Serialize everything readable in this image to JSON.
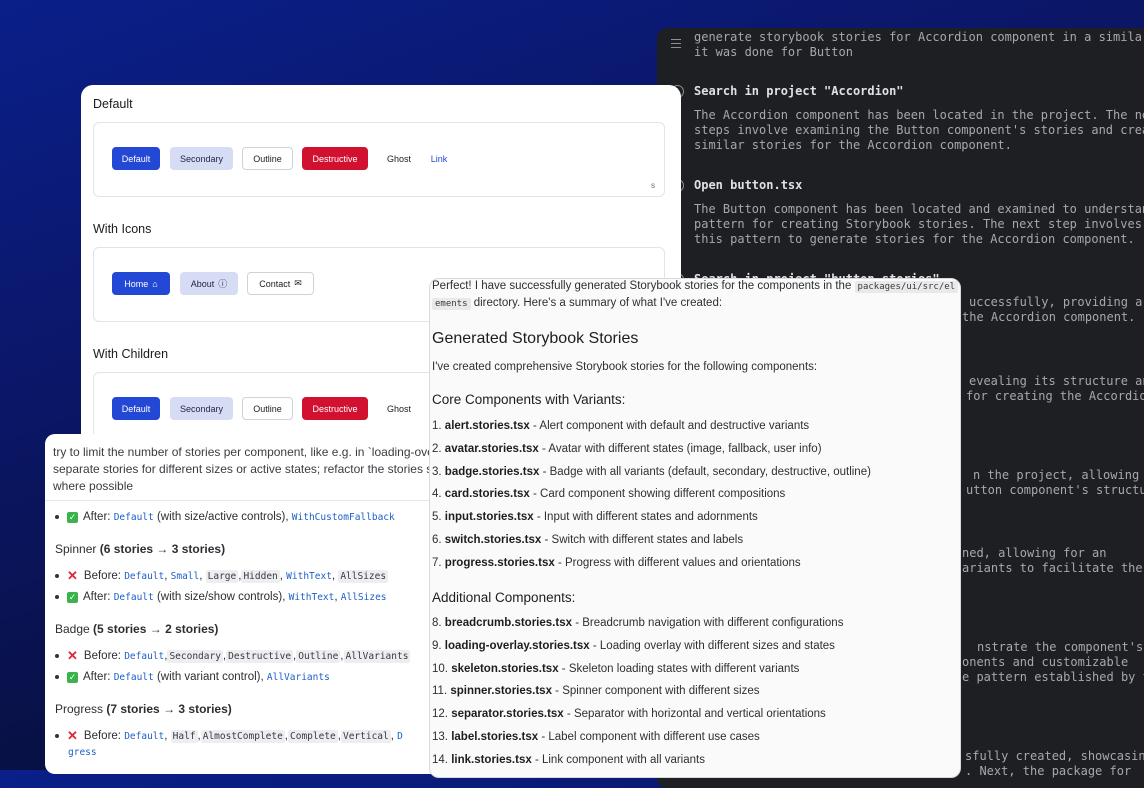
{
  "log": {
    "prompt": "generate storybook stories for Accordion component in a similar way as\nit was done for Button",
    "entries": [
      {
        "title": "Search in project \"Accordion\"",
        "body": "The Accordion component has been located in the project. The next\nsteps involve examining the Button component's stories and creating\nsimilar stories for the Accordion component."
      },
      {
        "title": "Open button.tsx",
        "body": "The Button component has been located and examined to understand the\npattern for creating Storybook stories. The next step involves using\nthis pattern to generate stories for the Accordion component."
      },
      {
        "title": "Search in project \"button.stories\"",
        "body": ""
      }
    ],
    "fragments": [
      "uccessfully, providing a",
      "the Accordion component.",
      "evealing its structure and",
      "for creating the Accordion",
      "n the project, allowing for",
      "utton component's structure.",
      "ned, allowing for an",
      "ariants to facilitate the",
      "nstrate the component's",
      "onents and customizable",
      "e pattern established by the",
      "sfully created, showcasing",
      ". Next, the package for"
    ]
  },
  "showcase": {
    "sections": [
      {
        "title": "Default",
        "buttons": [
          "Default",
          "Secondary",
          "Outline",
          "Destructive",
          "Ghost",
          "Link"
        ]
      },
      {
        "title": "With Icons",
        "buttons": [
          "Home",
          "About",
          "Contact"
        ]
      },
      {
        "title": "With Children",
        "buttons": [
          "Default",
          "Secondary",
          "Outline",
          "Destructive",
          "Ghost"
        ]
      }
    ],
    "cut_label": "s"
  },
  "refactor": {
    "intro_lines": [
      "try to limit the number of stories per component, like e.g. in `loading-over",
      "separate stories for different sizes or active states; refactor the stories so t",
      "where possible"
    ],
    "after_prefix": "After:",
    "before_prefix": "Before:",
    "avatar_after": {
      "note": "(with size/active controls),",
      "codes": [
        "Default",
        "WithCustomFallback"
      ]
    },
    "spinner": {
      "name": "Spinner",
      "count": "(6 stories → 3 stories)",
      "before": [
        "Default",
        "Small",
        "Large",
        "Hidden",
        "WithText",
        "AllSizes"
      ],
      "after_note": "(with size/show controls),",
      "after": [
        "Default",
        "WithText",
        "AllSizes"
      ]
    },
    "badge": {
      "name": "Badge",
      "count": "(5 stories → 2 stories)",
      "before": [
        "Default",
        "Secondary",
        "Destructive",
        "Outline",
        "AllVariants"
      ],
      "after_note": "(with variant control),",
      "after": [
        "Default",
        "AllVariants"
      ]
    },
    "progress": {
      "name": "Progress",
      "count": "(7 stories → 3 stories)",
      "before": [
        "Default",
        "Half",
        "AlmostComplete",
        "Complete",
        "Vertical",
        "D"
      ],
      "wrap": "gress"
    }
  },
  "summary": {
    "intro1": "Perfect! I have successfully generated Storybook stories for the components in the",
    "path_a": "packages/ui/src/el",
    "path_b": "ements",
    "intro2": "directory. Here's a summary of what I've created:",
    "h2": "Generated Storybook Stories",
    "lead": "I've created comprehensive Storybook stories for the following components:",
    "core_title": "Core Components with Variants:",
    "core": [
      {
        "n": "1.",
        "file": "alert.stories.tsx",
        "desc": "- Alert component with default and destructive variants"
      },
      {
        "n": "2.",
        "file": "avatar.stories.tsx",
        "desc": "- Avatar with different states (image, fallback, user info)"
      },
      {
        "n": "3.",
        "file": "badge.stories.tsx",
        "desc": "- Badge with all variants (default, secondary, destructive, outline)"
      },
      {
        "n": "4.",
        "file": "card.stories.tsx",
        "desc": "- Card component showing different compositions"
      },
      {
        "n": "5.",
        "file": "input.stories.tsx",
        "desc": "- Input with different states and adornments"
      },
      {
        "n": "6.",
        "file": "switch.stories.tsx",
        "desc": "- Switch with different states and labels"
      },
      {
        "n": "7.",
        "file": "progress.stories.tsx",
        "desc": "- Progress with different values and orientations"
      }
    ],
    "add_title": "Additional Components:",
    "additional": [
      {
        "n": "8.",
        "file": "breadcrumb.stories.tsx",
        "desc": "- Breadcrumb navigation with different configurations"
      },
      {
        "n": "9.",
        "file": "loading-overlay.stories.tsx",
        "desc": "- Loading overlay with different sizes and states"
      },
      {
        "n": "10.",
        "file": "skeleton.stories.tsx",
        "desc": "- Skeleton loading states with different variants"
      },
      {
        "n": "11.",
        "file": "spinner.stories.tsx",
        "desc": "- Spinner component with different sizes"
      },
      {
        "n": "12.",
        "file": "separator.stories.tsx",
        "desc": "- Separator with horizontal and vertical orientations"
      },
      {
        "n": "13.",
        "file": "label.stories.tsx",
        "desc": "- Label component with different use cases"
      },
      {
        "n": "14.",
        "file": "link.stories.tsx",
        "desc": "- Link component with all variants"
      }
    ]
  }
}
